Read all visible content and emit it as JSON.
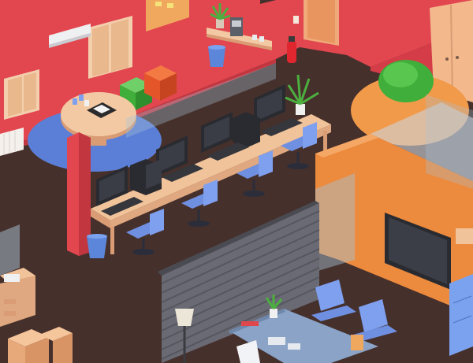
{
  "scene": {
    "description_free": true,
    "colors": {
      "wall_red": "#e2464f",
      "wall_red_dark": "#c23640",
      "floor_brown": "#46302c",
      "floor_dark": "#3a2826",
      "orange_wall": "#ec8a3d",
      "desk_tan": "#f1c39a",
      "desk_edge": "#d99c74",
      "monitor_black": "#2a2b30",
      "chair_blue": "#6f8fe0",
      "chair_dark": "#2b2e3a",
      "blue_rug": "#5b7fd6",
      "orange_rug": "#f19a4a",
      "green_beanbag": "#3fae3a",
      "glass": "#a9c3d8",
      "shutter_gray": "#6a6a74",
      "plant_green": "#4caf3f"
    },
    "icons": [
      "monitor-icon",
      "pc-tower-icon",
      "office-chair-icon",
      "plant-icon",
      "fire-extinguisher-icon",
      "coffee-machine-icon",
      "trash-bin-icon",
      "chess-board-icon",
      "beanbag-icon",
      "tv-screen-icon",
      "floor-lamp-icon",
      "cardboard-box-icon",
      "air-conditioner-icon"
    ]
  }
}
